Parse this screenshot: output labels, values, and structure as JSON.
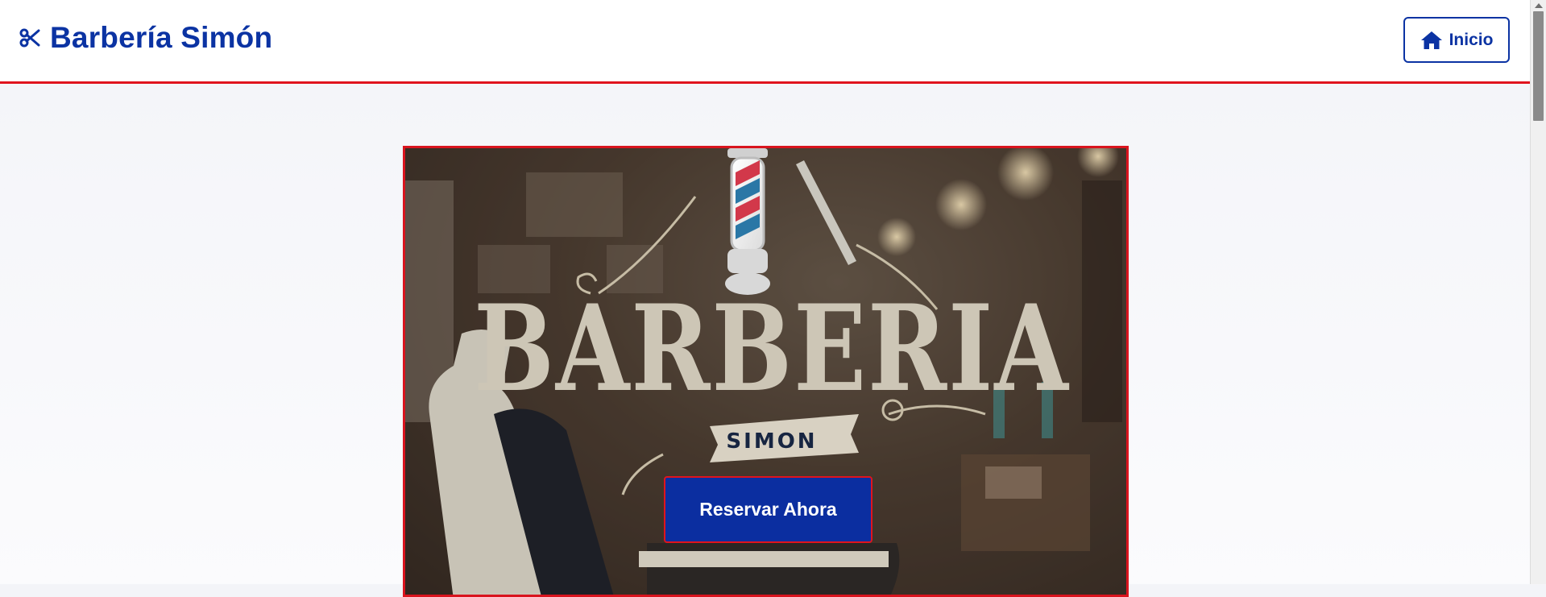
{
  "header": {
    "brand_icon": "scissors-icon",
    "brand_title": "Barbería Simón",
    "home_button": {
      "icon": "home-icon",
      "label": "Inicio"
    }
  },
  "hero": {
    "image_title": "BARBERIA",
    "image_subtitle": "SIMON",
    "cta_label": "Reservar Ahora"
  },
  "colors": {
    "brand_blue": "#0b33a3",
    "accent_red": "#e0141e",
    "cta_blue": "#0b2ea0"
  }
}
